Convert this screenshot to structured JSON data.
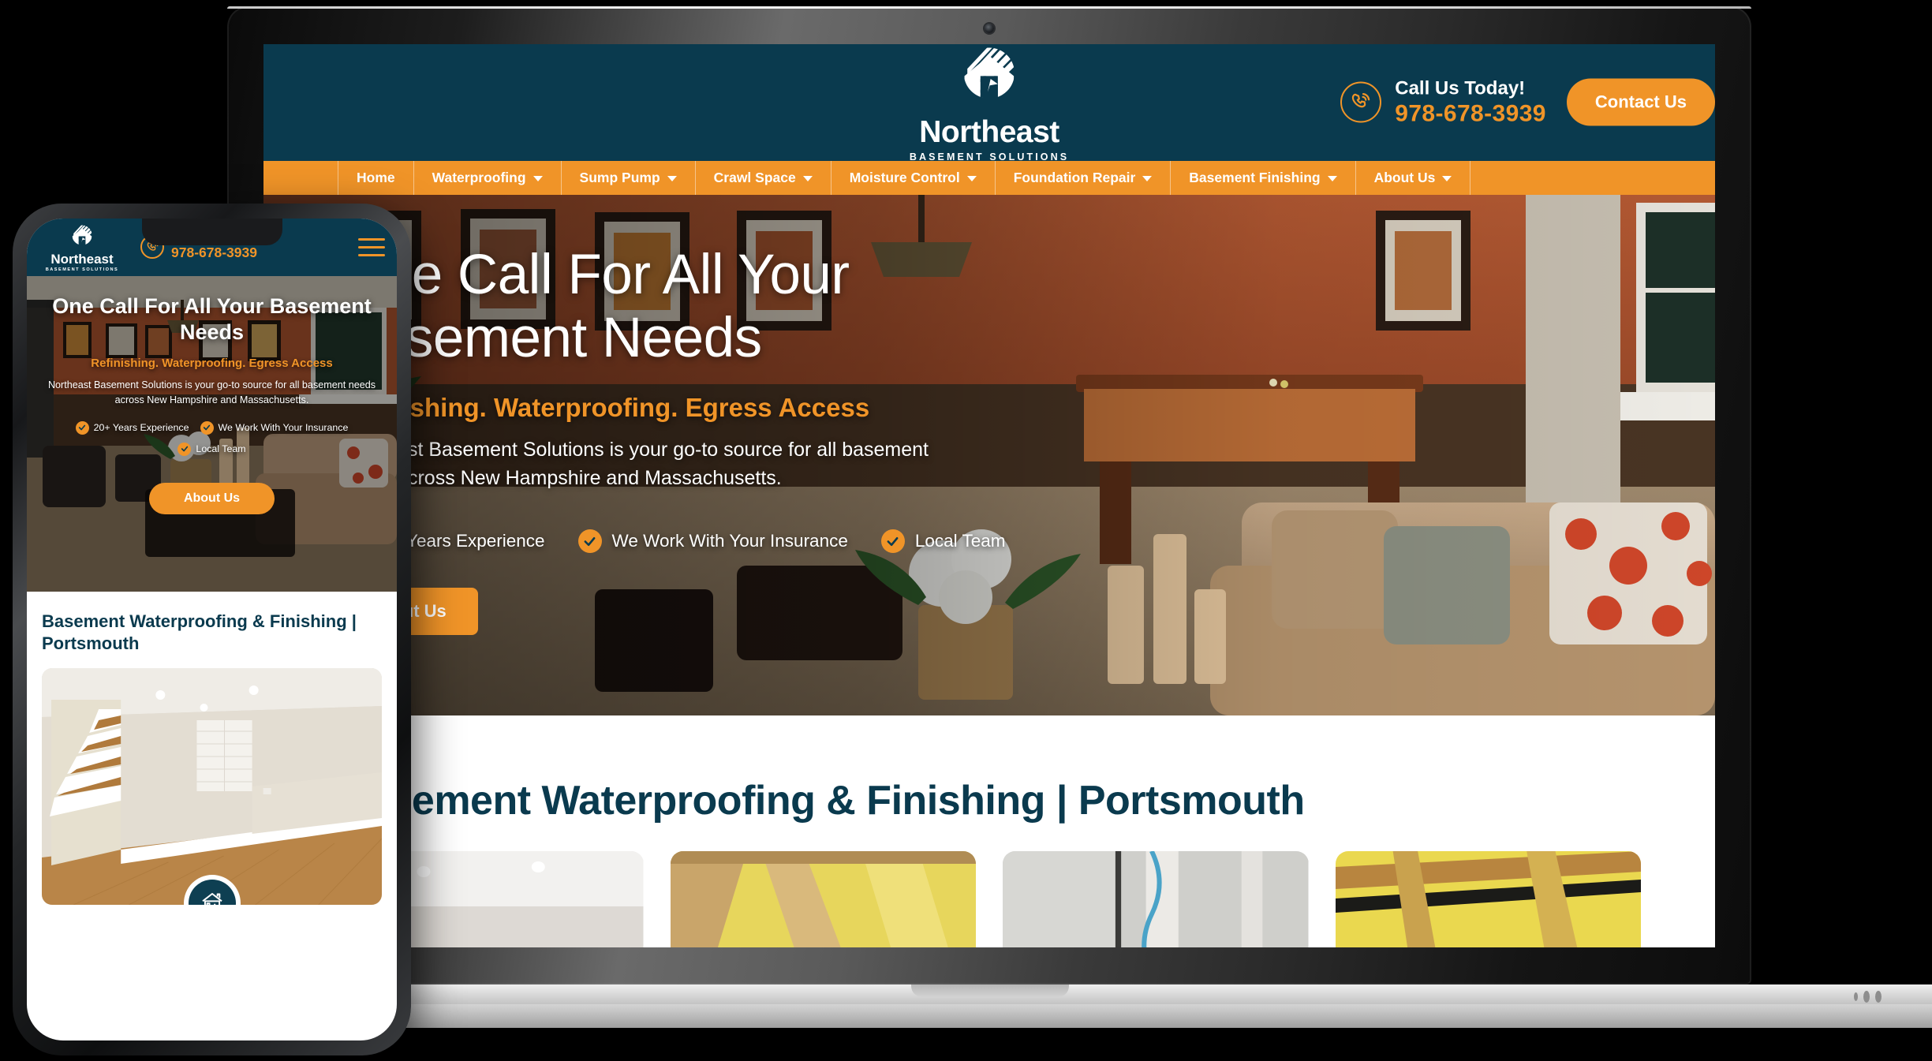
{
  "brand": {
    "name": "Northeast",
    "tagline": "BASEMENT SOLUTIONS",
    "logo_icon": "house-logo-icon"
  },
  "colors": {
    "dark_teal": "#0a3a4e",
    "orange": "#f09428",
    "white": "#ffffff"
  },
  "header": {
    "call_label": "Call Us Today!",
    "phone": "978-678-3939",
    "phone_icon": "phone-ring-icon",
    "contact_button": "Contact Us"
  },
  "nav": {
    "items": [
      {
        "label": "Home",
        "has_dropdown": false
      },
      {
        "label": "Waterproofing",
        "has_dropdown": true
      },
      {
        "label": "Sump Pump",
        "has_dropdown": true
      },
      {
        "label": "Crawl Space",
        "has_dropdown": true
      },
      {
        "label": "Moisture Control",
        "has_dropdown": true
      },
      {
        "label": "Foundation Repair",
        "has_dropdown": true
      },
      {
        "label": "Basement Finishing",
        "has_dropdown": true
      },
      {
        "label": "About Us",
        "has_dropdown": true
      }
    ]
  },
  "hero": {
    "heading": "One Call For All Your Basement Needs",
    "subheading": "Refinishing. Waterproofing. Egress Access",
    "paragraph": "Northeast Basement Solutions is your go-to source for all basement needs across New Hampshire and Massachusetts.",
    "features": [
      "20+ Years Experience",
      "We Work With Your Insurance",
      "Local Team"
    ],
    "cta_button": "About Us",
    "check_icon": "check-circle-icon"
  },
  "section": {
    "title": "Basement Waterproofing & Finishing | Portsmouth",
    "cards": [
      {
        "name": "finished-basement-photo"
      },
      {
        "name": "insulation-framing-photo"
      },
      {
        "name": "concrete-wall-photo"
      },
      {
        "name": "insulated-ceiling-photo"
      }
    ]
  },
  "mobile": {
    "menu_icon": "hamburger-menu-icon",
    "home_badge_icon": "house-basement-icon",
    "heading": "One Call For All Your Basement Needs",
    "subheading": "Refinishing. Waterproofing. Egress Access",
    "paragraph": "Northeast Basement Solutions is your go-to source for all basement needs across New Hampshire and Massachusetts.",
    "features": [
      "20+ Years Experience",
      "We Work With Your Insurance",
      "Local Team"
    ],
    "cta_button": "About Us",
    "section_title": "Basement Waterproofing & Finishing | Portsmouth",
    "photo_name": "finished-basement-stairs-photo"
  },
  "devices": {
    "laptop_name": "laptop-mockup",
    "phone_name": "phone-mockup"
  }
}
